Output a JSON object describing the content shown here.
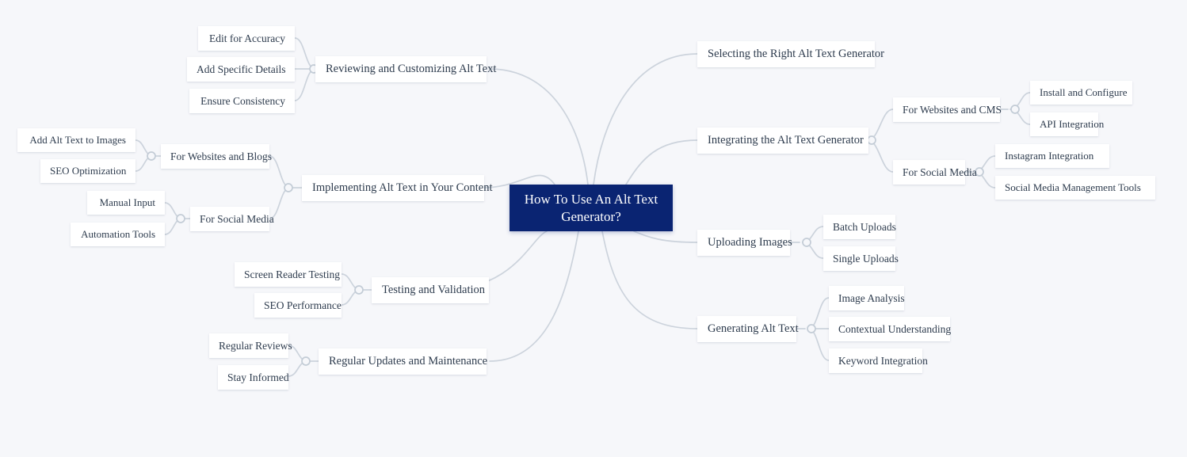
{
  "canvas": {
    "background_color": "#f6f7fa",
    "edge_color": "#ccd3dc",
    "node_background": "#ffffff",
    "node_text_color": "#2e3c4e",
    "root_background": "#0a2472",
    "root_text_color": "#ffffff"
  },
  "root": {
    "label": "How To Use An Alt Text Generator?"
  },
  "right_branches": [
    {
      "label": "Selecting the Right Alt Text Generator",
      "children": []
    },
    {
      "label": "Integrating the Alt Text Generator",
      "children": [
        {
          "label": "For Websites and CMS",
          "children": [
            {
              "label": "Install and Configure"
            },
            {
              "label": "API Integration"
            }
          ]
        },
        {
          "label": "For Social Media",
          "children": [
            {
              "label": "Instagram Integration"
            },
            {
              "label": "Social Media Management Tools"
            }
          ]
        }
      ]
    },
    {
      "label": "Uploading Images",
      "children": [
        {
          "label": "Batch Uploads",
          "children": []
        },
        {
          "label": "Single Uploads",
          "children": []
        }
      ]
    },
    {
      "label": "Generating Alt Text",
      "children": [
        {
          "label": "Image Analysis",
          "children": []
        },
        {
          "label": "Contextual Understanding",
          "children": []
        },
        {
          "label": "Keyword Integration",
          "children": []
        }
      ]
    }
  ],
  "left_branches": [
    {
      "label": "Reviewing and Customizing Alt Text",
      "children": [
        {
          "label": "Edit for Accuracy",
          "children": []
        },
        {
          "label": "Add Specific Details",
          "children": []
        },
        {
          "label": "Ensure Consistency",
          "children": []
        }
      ]
    },
    {
      "label": "Implementing Alt Text in Your Content",
      "children": [
        {
          "label": "For Websites and Blogs",
          "children": [
            {
              "label": "Add Alt Text to Images"
            },
            {
              "label": "SEO Optimization"
            }
          ]
        },
        {
          "label": "For Social Media",
          "children": [
            {
              "label": "Manual Input"
            },
            {
              "label": "Automation Tools"
            }
          ]
        }
      ]
    },
    {
      "label": "Testing and Validation",
      "children": [
        {
          "label": "Screen Reader Testing",
          "children": []
        },
        {
          "label": "SEO Performance",
          "children": []
        }
      ]
    },
    {
      "label": "Regular Updates and Maintenance",
      "children": [
        {
          "label": "Regular Reviews",
          "children": []
        },
        {
          "label": "Stay Informed",
          "children": []
        }
      ]
    }
  ]
}
